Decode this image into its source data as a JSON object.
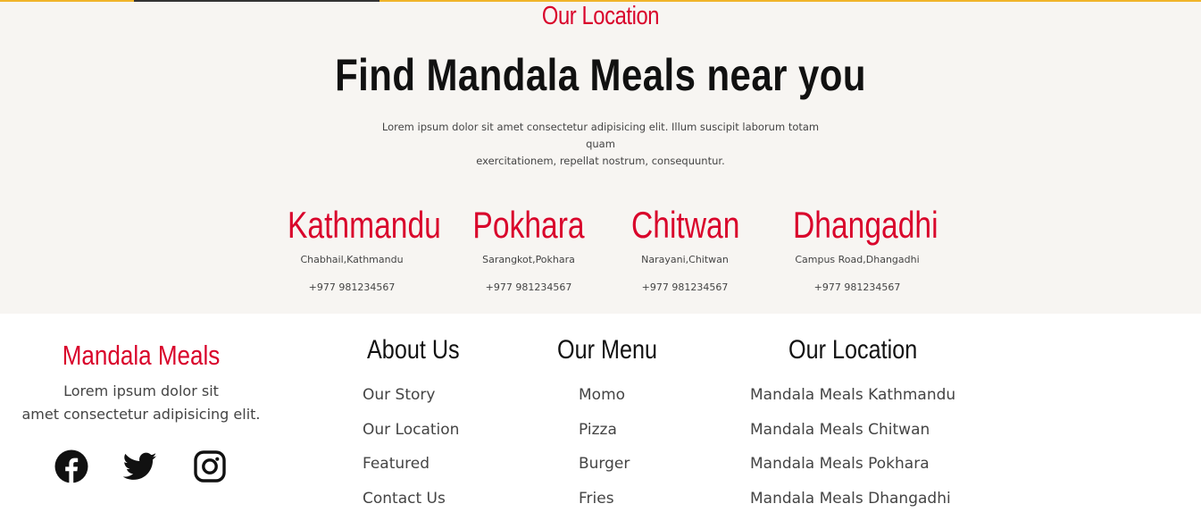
{
  "location": {
    "eyebrow": "Our Location",
    "heading": "Find Mandala Meals near you",
    "intro_line1": "Lorem ipsum dolor sit amet consectetur adipisicing elit. Illum suscipit laborum totam quam",
    "intro_line2": "exercitationem, repellat nostrum, consequuntur.",
    "cities": [
      {
        "name": "Kathmandu",
        "address": "Chabhail,Kathmandu",
        "phone": "+977 981234567"
      },
      {
        "name": "Pokhara",
        "address": "Sarangkot,Pokhara",
        "phone": "+977 981234567"
      },
      {
        "name": "Chitwan",
        "address": "Narayani,Chitwan",
        "phone": "+977 981234567"
      },
      {
        "name": "Dhangadhi",
        "address": "Campus Road,Dhangadhi",
        "phone": "+977 981234567"
      }
    ]
  },
  "footer": {
    "brand": {
      "name": "Mandala Meals",
      "tagline_line1": "Lorem ipsum dolor sit",
      "tagline_line2": "amet consectetur adipisicing elit."
    },
    "socials": [
      {
        "icon": "facebook-icon"
      },
      {
        "icon": "twitter-icon"
      },
      {
        "icon": "instagram-icon"
      }
    ],
    "columns": [
      {
        "title": "About Us",
        "links": [
          "Our Story",
          "Our Location",
          "Featured",
          "Contact Us"
        ]
      },
      {
        "title": "Our Menu",
        "links": [
          "Momo",
          "Pizza",
          "Burger",
          "Fries"
        ]
      },
      {
        "title": "Our Location",
        "links": [
          "Mandala Meals Kathmandu",
          "Mandala Meals Chitwan",
          "Mandala Meals Pokhara",
          "Mandala Meals Dhangadhi"
        ]
      }
    ]
  },
  "colors": {
    "accent": "#d9042b",
    "section_bg": "#f7f5f2",
    "heading": "#111111",
    "body_text": "#444444",
    "top_border": "#f0b42a"
  }
}
